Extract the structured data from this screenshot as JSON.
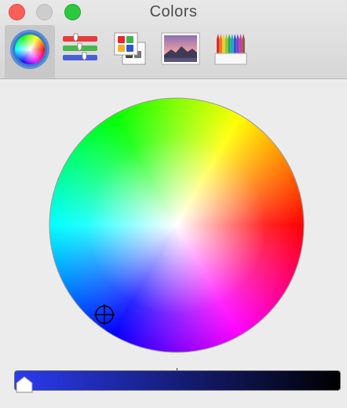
{
  "window": {
    "title": "Colors"
  },
  "tabs": [
    {
      "id": "color-wheel",
      "icon": "color-wheel-icon",
      "selected": true
    },
    {
      "id": "color-sliders",
      "icon": "sliders-icon",
      "selected": false
    },
    {
      "id": "color-palettes",
      "icon": "palettes-icon",
      "selected": false
    },
    {
      "id": "image-palettes",
      "icon": "image-palette-icon",
      "selected": false
    },
    {
      "id": "pencils",
      "icon": "pencils-icon",
      "selected": false
    }
  ],
  "brightness": {
    "value": 1.0
  },
  "colors": {
    "selected_tab_bg": "#c8c8c8",
    "slider_start": "#2a3bf0",
    "slider_end": "#000000",
    "close": "#fd5e57",
    "minimize": "#cdcdcd",
    "zoom": "#2ac940"
  }
}
